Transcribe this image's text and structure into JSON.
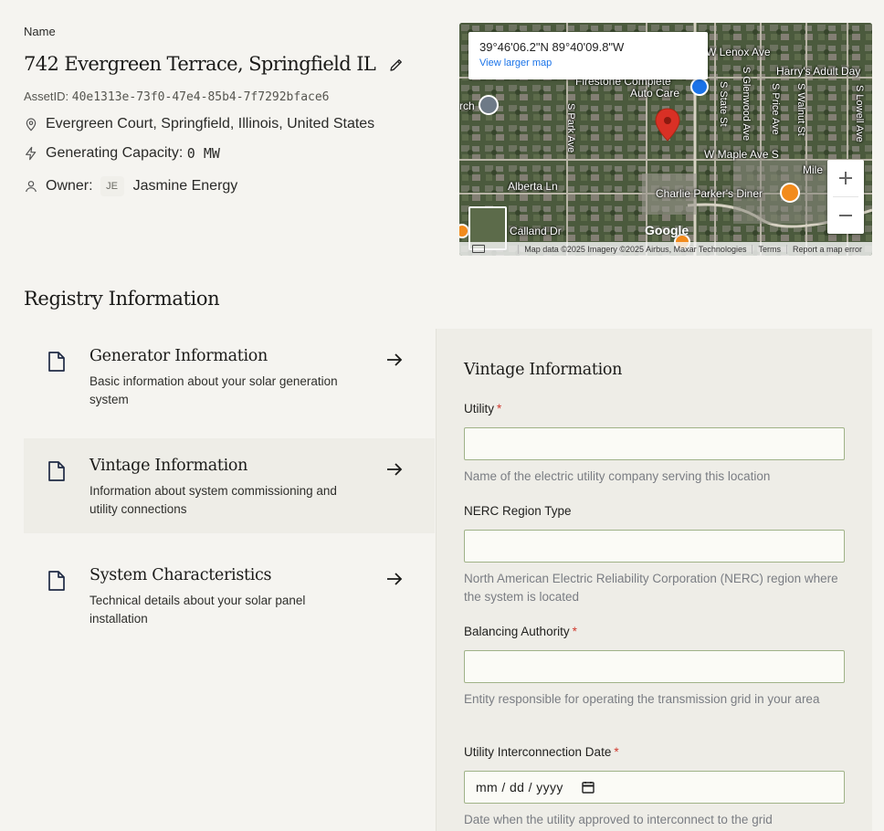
{
  "header": {
    "name_label": "Name",
    "title": "742 Evergreen Terrace, Springfield IL",
    "asset_id_label": "AssetID:",
    "asset_id": "40e1313e-73f0-47e4-85b4-7f7292bface6",
    "location": "Evergreen Court, Springfield, Illinois, United States",
    "capacity_label": "Generating Capacity:",
    "capacity_value": "0 MW",
    "owner_label": "Owner:",
    "owner_initials": "JE",
    "owner_name": "Jasmine Energy"
  },
  "map": {
    "coordinates": "39°46'06.2\"N 89°40'09.8\"W",
    "view_larger": "View larger map",
    "google": "Google",
    "footer_data": "Map data ©2025 Imagery ©2025 Airbus, Maxar Technologies",
    "footer_terms": "Terms",
    "footer_report": "Report a map error",
    "labels": {
      "lenox": "W Lenox Ave",
      "harrys": "Harry's Adult Day",
      "firestone1": "Firestone Complete",
      "firestone2": "Auto Care",
      "maple": "W Maple Ave S",
      "alberta": "Alberta Ln",
      "charlie": "Charlie Parker's Diner",
      "calland": "Calland Dr",
      "mile": "Mile",
      "park": "S Park Ave",
      "state": "S State St",
      "glenwood": "S Glenwood Ave",
      "price": "S Price Ave",
      "walnut": "S Walnut St",
      "lowell": "S Lowell Ave",
      "rch": "rch"
    }
  },
  "registry": {
    "title": "Registry Information",
    "items": [
      {
        "title": "Generator Information",
        "desc": "Basic information about your solar generation system"
      },
      {
        "title": "Vintage Information",
        "desc": "Information about system commissioning and utility connections"
      },
      {
        "title": "System Characteristics",
        "desc": "Technical details about your solar panel installation"
      }
    ]
  },
  "form": {
    "title": "Vintage Information",
    "fields": [
      {
        "label": "Utility",
        "required": "*",
        "value": "",
        "help": "Name of the electric utility company serving this location"
      },
      {
        "label": "NERC Region Type",
        "value": "",
        "help": "North American Electric Reliability Corporation (NERC) region where the system is located"
      },
      {
        "label": "Balancing Authority",
        "required": "*",
        "value": "",
        "help": "Entity responsible for operating the transmission grid in your area"
      },
      {
        "label": "Utility Interconnection Date",
        "required": "*",
        "placeholder": "mm / dd / yyyy",
        "help": "Date when the utility approved to interconnect to the grid"
      }
    ]
  },
  "colors": {
    "background": "#f5f4f0",
    "panel": "#eeede7",
    "input_border": "#9fb287",
    "required": "#d03a2f",
    "help_text": "#7a7d83",
    "map_pin": "#d93025"
  },
  "icons": {
    "edit": "pencil-icon",
    "location": "location-pin-icon",
    "capacity": "lightning-icon",
    "owner": "user-icon",
    "document": "document-icon",
    "arrow": "arrow-right-icon",
    "calendar": "calendar-icon",
    "zoom_in": "plus-icon",
    "zoom_out": "minus-icon"
  }
}
